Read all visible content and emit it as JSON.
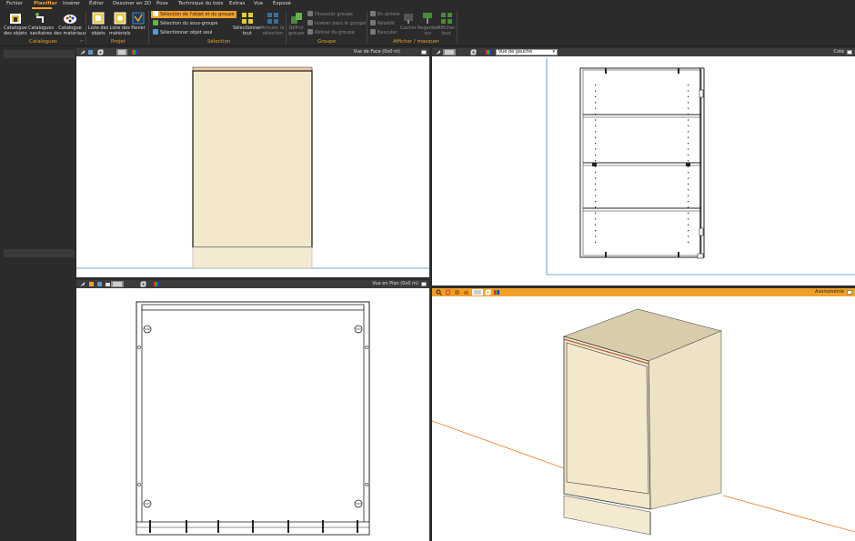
{
  "menu": [
    "Fichier",
    "Planifier",
    "Insérer",
    "Éditer",
    "Dessiner en 2D",
    "Pose",
    "Technique du bois",
    "Extras",
    "Vue",
    "Exposé"
  ],
  "menu_active": "Planifier",
  "ribbon": {
    "catalogues": {
      "group": "Catalogues",
      "btn1": [
        "Catalogue",
        "des objets"
      ],
      "btn2": [
        "Catalogues",
        "sanitaires"
      ],
      "btn3": [
        "Catalogue",
        "des matériaux"
      ]
    },
    "projet": {
      "group": "Projet",
      "btn1": [
        "Liste des",
        "objets"
      ],
      "btn2": [
        "Liste des",
        "matériels"
      ],
      "btn3": "Panier"
    },
    "selection": {
      "group": "Sélection",
      "opt1": "Sélection de l'objet et du groupe",
      "opt2": "Sélection du sous-groupe",
      "opt3": "Sélectionner objet seul",
      "btn1": [
        "Sélectionner",
        "tout"
      ],
      "btn2": [
        "Annuler la",
        "sélection"
      ]
    },
    "groupe": {
      "group": "Groupe",
      "btn1": [
        "Définir",
        "groupe"
      ],
      "opt1": "Dissocier groupe",
      "opt2": "Insérer dans le groupe",
      "opt3": "Retirer du groupe"
    },
    "afficher": {
      "group": "Afficher / masquer",
      "opt1": "En arrière",
      "opt2": "Rétablir",
      "opt3": "Basculer",
      "btn1": "Cacher",
      "btn2": [
        "Regarder",
        "sur"
      ],
      "btn3": [
        "Afficher",
        "tout"
      ]
    }
  },
  "viewports": {
    "front": {
      "title": "Vue de Face  (0x0 m)"
    },
    "left": {
      "title": "Coté",
      "select_value": "Vue de gauche"
    },
    "plan": {
      "title": "Vue en Plan  (0x0 m)"
    },
    "axo": {
      "title": "Axonométrie"
    }
  },
  "colors": {
    "accent": "#f0a028",
    "cabinet_body": "#f3e8cc",
    "cabinet_side": "#ede2c6",
    "cabinet_top": "#d8ccaa",
    "plinth": "#f4ead2",
    "axis_orange": "#f07820",
    "axis_blue": "#3c8cc8"
  }
}
